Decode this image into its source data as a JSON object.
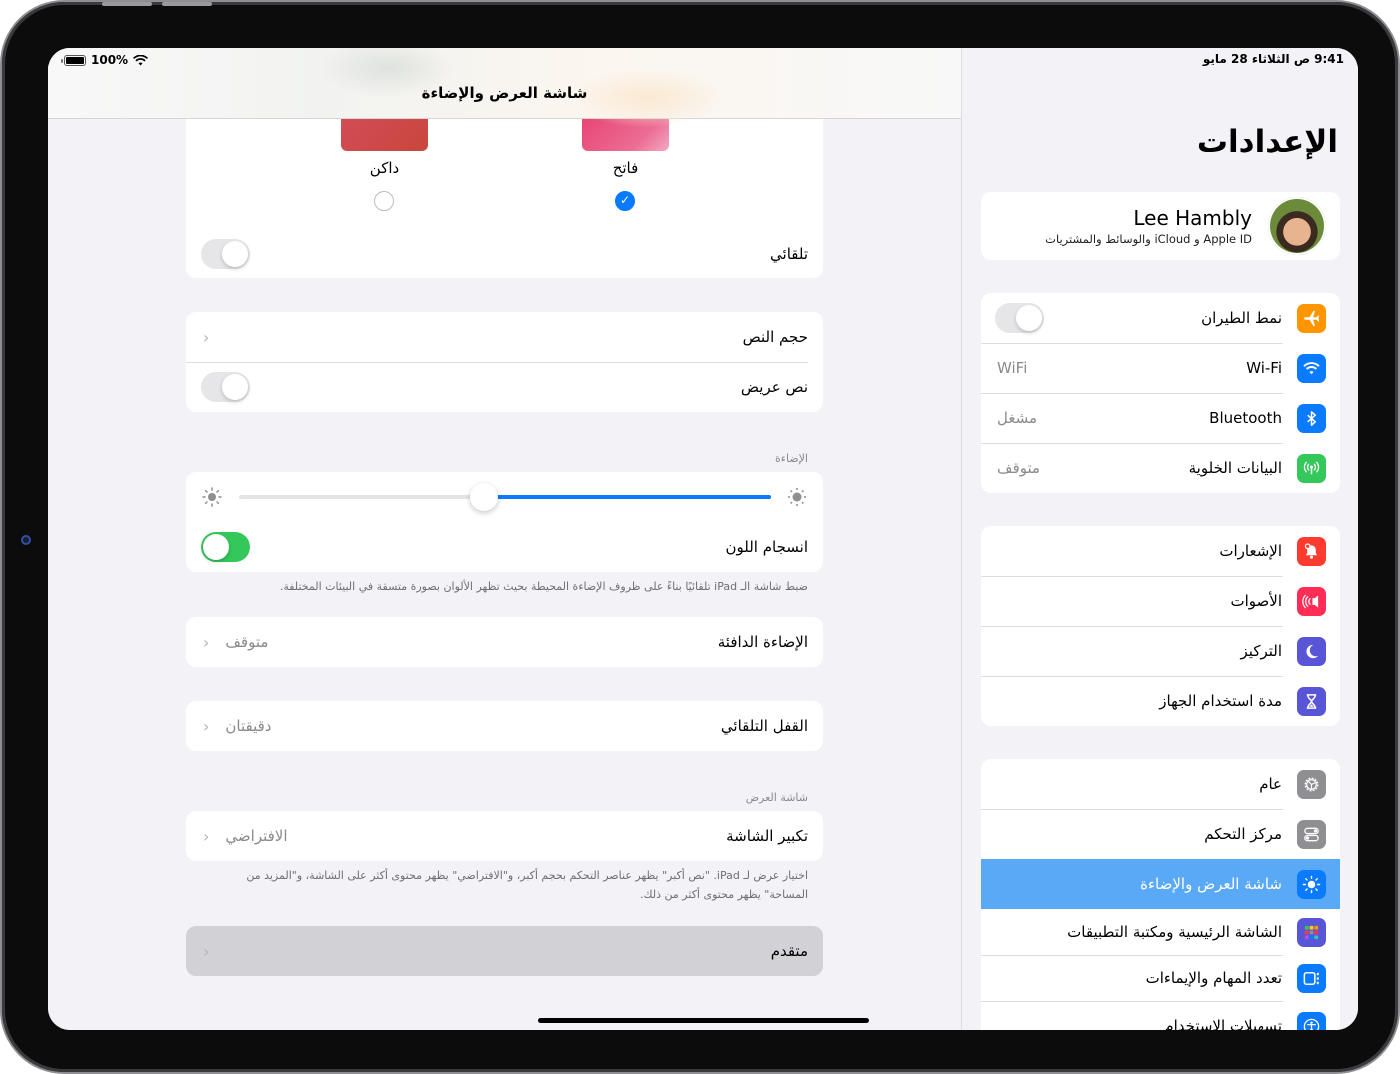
{
  "status_bar": {
    "battery": "100%",
    "time_date": "9:41 ص   الثلاثاء 28 مايو"
  },
  "detail": {
    "title": "شاشة العرض والإضاءة",
    "appearance": {
      "options": [
        {
          "label": "فاتح",
          "selected": true
        },
        {
          "label": "داكن",
          "selected": false
        }
      ],
      "automatic_label": "تلقائي",
      "automatic_on": false
    },
    "text": {
      "text_size_label": "حجم النص",
      "bold_text_label": "نص عريض",
      "bold_text_on": false
    },
    "brightness": {
      "header": "الإضاءة",
      "level_percent": 54,
      "true_tone_label": "انسجام اللون",
      "true_tone_on": true,
      "footnote": "ضبط شاشة الـ iPad تلقائيًا بناءً على ظروف الإضاءة المحيطة بحيث تظهر الألوان بصورة متسقة في البيئات المختلفة."
    },
    "night_shift": {
      "label": "الإضاءة الدافئة",
      "value": "متوقف"
    },
    "auto_lock": {
      "label": "القفل التلقائي",
      "value": "دقيقتان"
    },
    "display": {
      "header": "شاشة العرض",
      "zoom_label": "تكبير الشاشة",
      "zoom_value": "الافتراضي",
      "footnote": "اختيار عرض لـ iPad. \"نص أكبر\" يظهر عناصر التحكم بحجم أكبر، و\"الافتراضي\" يظهر محتوى أكثر على الشاشة، و\"المزيد من المساحة\" يظهر محتوى أكثر من ذلك."
    },
    "advanced_label": "متقدم"
  },
  "sidebar": {
    "title": "الإعدادات",
    "profile": {
      "name": "Lee Hambly",
      "subtitle": "Apple ID و iCloud والوسائط والمشتريات"
    },
    "groups": [
      [
        {
          "id": "airplane",
          "label": "نمط الطيران",
          "icon": "airplane-icon",
          "color": "#ff9500",
          "toggle": false
        },
        {
          "id": "wifi",
          "label": "Wi-Fi",
          "icon": "wifi-icon",
          "color": "#0a7aff",
          "value": "WiFi"
        },
        {
          "id": "bluetooth",
          "label": "Bluetooth",
          "icon": "bluetooth-icon",
          "color": "#0a7aff",
          "value": "مشغل"
        },
        {
          "id": "cellular",
          "label": "البيانات الخلوية",
          "icon": "cellular-antenna-icon",
          "color": "#34c759",
          "value": "متوقف"
        }
      ],
      [
        {
          "id": "notifications",
          "label": "الإشعارات",
          "icon": "bell-icon",
          "color": "#ff3b30"
        },
        {
          "id": "sounds",
          "label": "الأصوات",
          "icon": "speaker-icon",
          "color": "#ff2d55"
        },
        {
          "id": "focus",
          "label": "التركيز",
          "icon": "moon-icon",
          "color": "#5856d6"
        },
        {
          "id": "screen_time",
          "label": "مدة استخدام الجهاز",
          "icon": "hourglass-icon",
          "color": "#5856d6"
        }
      ],
      [
        {
          "id": "general",
          "label": "عام",
          "icon": "gear-icon",
          "color": "#8e8e93"
        },
        {
          "id": "control_center",
          "label": "مركز التحكم",
          "icon": "switches-icon",
          "color": "#8e8e93"
        },
        {
          "id": "display",
          "label": "شاشة العرض والإضاءة",
          "icon": "sun-icon",
          "color": "#0a7aff",
          "selected": true
        },
        {
          "id": "home_screen",
          "label": "الشاشة الرئيسية ومكتبة التطبيقات",
          "icon": "app-grid-icon",
          "color": "#5856d6"
        },
        {
          "id": "multitasking",
          "label": "تعدد المهام والإيماءات",
          "icon": "multitasking-icon",
          "color": "#0a7aff"
        },
        {
          "id": "accessibility",
          "label": "تسهيلات الاستخدام",
          "icon": "accessibility-icon",
          "color": "#0a7aff"
        }
      ]
    ]
  },
  "colors": {
    "accent": "#0a7aff",
    "selected_row": "#5aa9f7",
    "toggle_on": "#34c759",
    "background": "#f2f2f7"
  }
}
